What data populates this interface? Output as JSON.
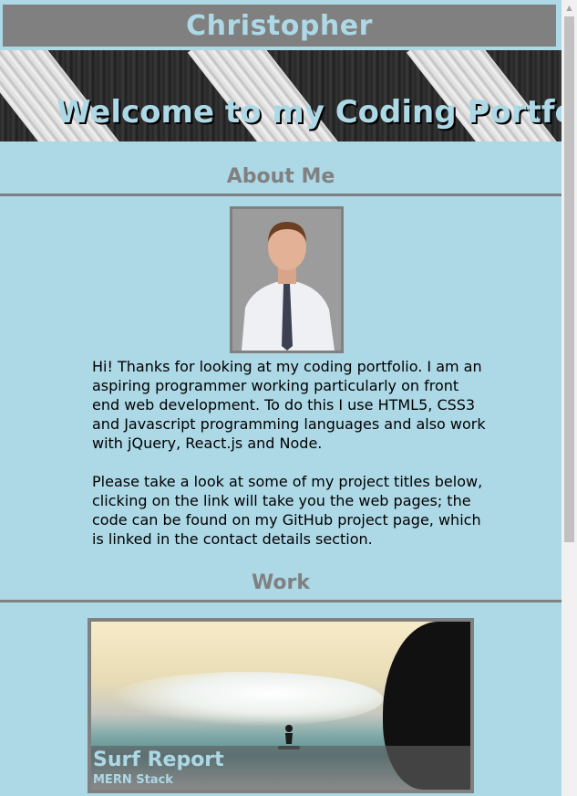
{
  "header": {
    "name": "Christopher"
  },
  "hero": {
    "title": "Welcome to my Coding Portfolio!"
  },
  "about": {
    "heading": "About Me",
    "paragraphs": [
      "Hi! Thanks for looking at my coding portfolio. I am an aspiring programmer working particularly on front end web development. To do this I use HTML5, CSS3 and Javascript programming languages and also work with jQuery, React.js and Node.",
      "Please take a look at some of my project titles below, clicking on the link will take you the web pages; the code can be found on my GitHub project page, which is linked in the contact details section."
    ]
  },
  "work": {
    "heading": "Work",
    "projects": [
      {
        "title": "Surf Report",
        "subtitle": "MERN Stack"
      }
    ]
  },
  "colors": {
    "accent": "#add8e6",
    "grey": "#808080"
  }
}
